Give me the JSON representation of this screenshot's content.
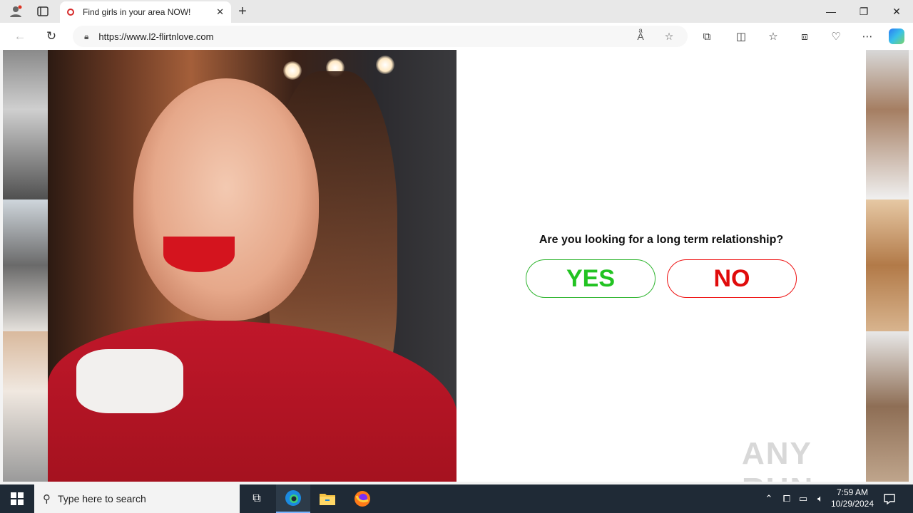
{
  "browser": {
    "tab_title": "Find girls in your area NOW!",
    "url": "https://www.l2-flirtnlove.com"
  },
  "page": {
    "question": "Are you looking for a long term relationship?",
    "yes_label": "YES",
    "no_label": "NO",
    "watermark": "ANY RUN"
  },
  "taskbar": {
    "search_placeholder": "Type here to search",
    "time": "7:59 AM",
    "date": "10/29/2024"
  },
  "colors": {
    "yes": "#22c322",
    "no": "#e00b0b",
    "taskbar": "#1f2a36"
  },
  "icons": [
    "profile-icon",
    "tab-actions-icon",
    "new-tab-icon",
    "back-icon",
    "refresh-icon",
    "lock-icon",
    "read-aloud-icon",
    "favorite-star-icon",
    "extensions-icon",
    "split-screen-icon",
    "favorites-icon",
    "collections-icon",
    "browser-essentials-icon",
    "more-icon",
    "copilot-icon",
    "windows-icon",
    "search-icon",
    "task-view-icon",
    "edge-icon",
    "file-explorer-icon",
    "firefox-icon"
  ]
}
